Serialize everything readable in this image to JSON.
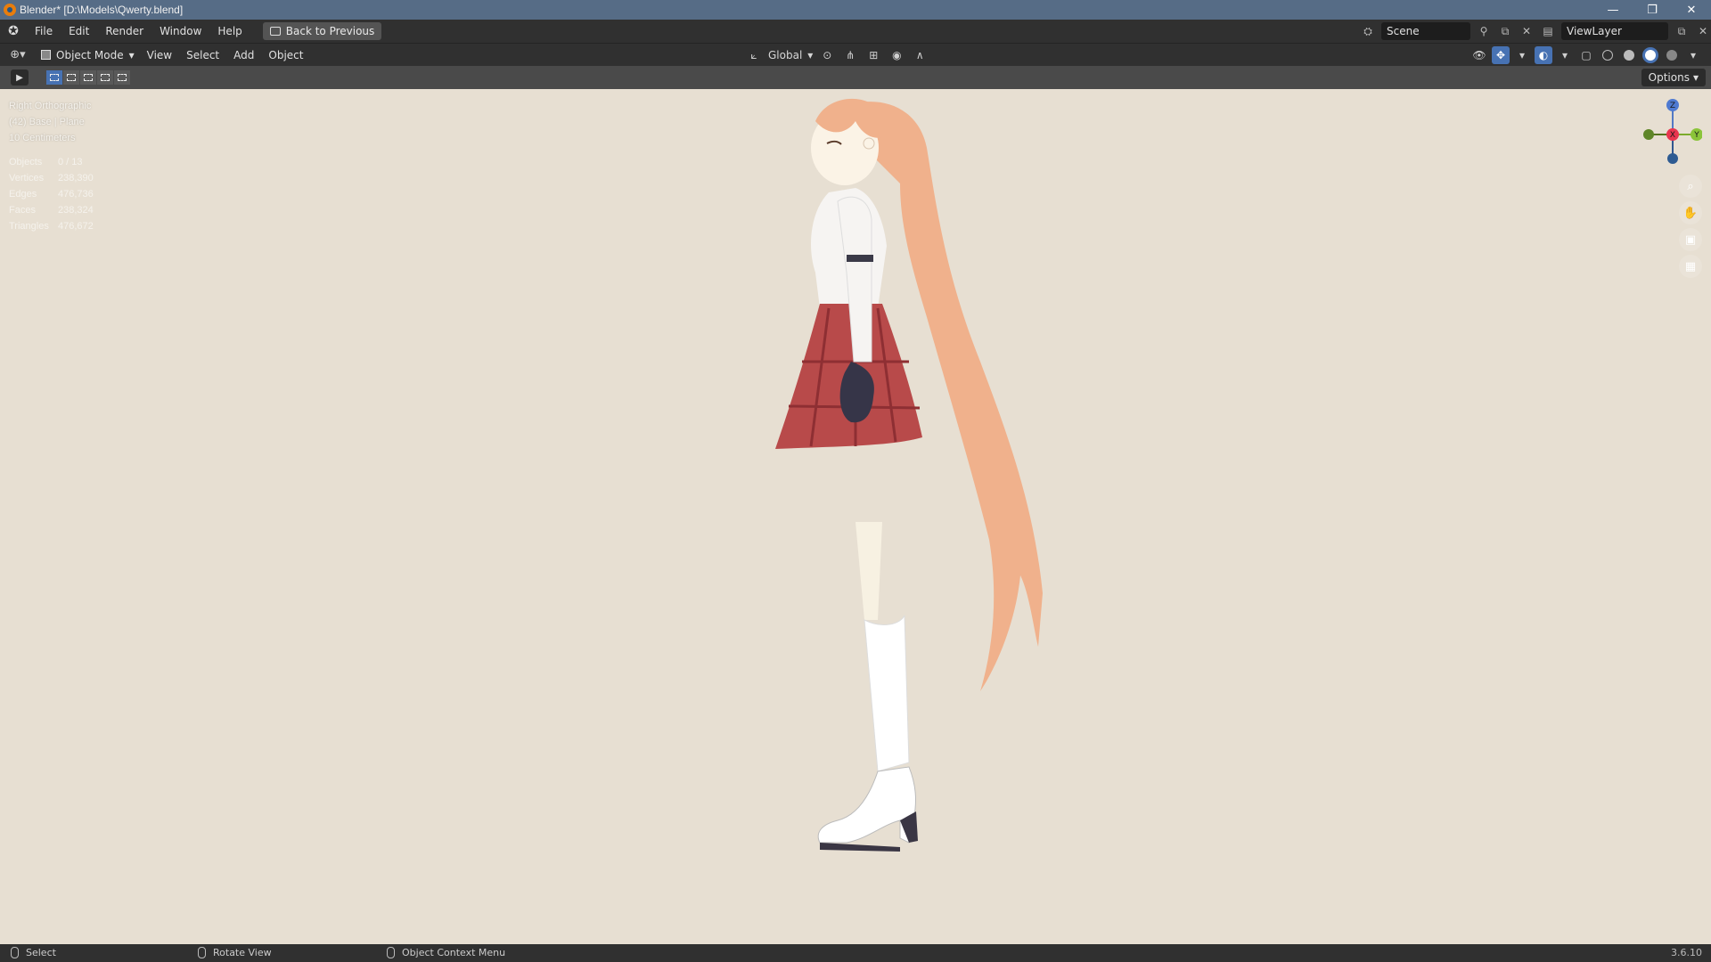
{
  "titlebar": {
    "title": "Blender* [D:\\Models\\Qwerty.blend]",
    "minimize": "—",
    "maximize": "❐",
    "close": "✕"
  },
  "menubar": {
    "items": [
      "File",
      "Edit",
      "Render",
      "Window",
      "Help"
    ],
    "back_button": "Back to Previous",
    "scene_name": "Scene",
    "view_layer": "ViewLayer"
  },
  "viewport_header": {
    "mode": "Object Mode",
    "menus": [
      "View",
      "Select",
      "Add",
      "Object"
    ],
    "transform_orientation": "Global"
  },
  "tool_header": {
    "options_label": "Options"
  },
  "viewport": {
    "view_name": "Right Orthographic",
    "collection": "(42) Base | Plane",
    "scale": "10 Centimeters",
    "stats": [
      {
        "label": "Objects",
        "value": "0 / 13"
      },
      {
        "label": "Vertices",
        "value": "238,390"
      },
      {
        "label": "Edges",
        "value": "476,736"
      },
      {
        "label": "Faces",
        "value": "238,324"
      },
      {
        "label": "Triangles",
        "value": "476,672"
      }
    ],
    "gizmo": {
      "z": "Z",
      "y": "Y",
      "x": "X"
    },
    "colors": {
      "background": "#e7dfd2",
      "hair": "#f2b48f",
      "skirt": "#b84a4a",
      "accent": "#4772b3"
    }
  },
  "statusbar": {
    "select": "Select",
    "rotate": "Rotate View",
    "context_menu": "Object Context Menu",
    "version": "3.6.10"
  }
}
